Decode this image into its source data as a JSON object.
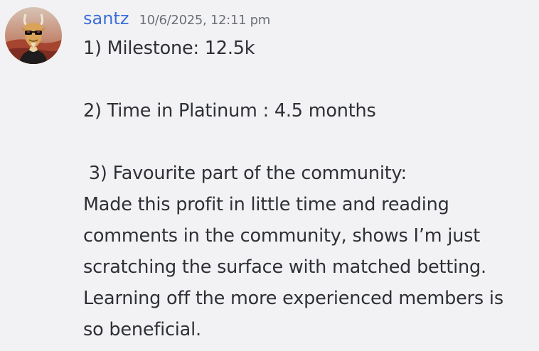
{
  "message": {
    "author": "santz",
    "timestamp": "10/6/2025, 12:11 pm",
    "avatar_icon": "goat-with-sunglasses-avatar",
    "colors": {
      "author": "#3c6fd9",
      "timestamp": "#6c6f78",
      "text": "#2e3035",
      "background": "#f2f2f4"
    },
    "lines": [
      "1) Milestone: 12.5k",
      "",
      "2) Time in Platinum : 4.5 months",
      "",
      " 3) Favourite part of the community:",
      "Made this profit in little time and reading",
      "comments in the community, shows I’m just",
      "scratching the surface with matched betting.",
      "Learning off the more experienced members is",
      "so beneficial."
    ]
  }
}
